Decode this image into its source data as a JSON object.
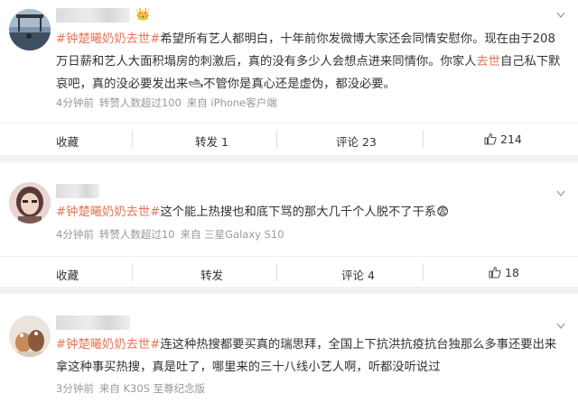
{
  "posts": [
    {
      "topic": "#钟楚曦奶奶去世#",
      "lines": [
        {
          "pre": "希望所有艺人都明白，十年前你发微博大家还会同情安慰你。现在由于208",
          "hl": "",
          "post": ""
        },
        {
          "pre": "万日薪和艺人大面积塌房的刺激后，真的没有多少人会想点进来同情你。你家人",
          "hl": "去世",
          "post": "自己私下默"
        },
        {
          "pre": "哀吧，真的没必要发出来",
          "emoji": "🛥",
          "post2": "不管你是真心还是虚伪，都没必要。"
        }
      ],
      "meta": {
        "time": "4分钟前",
        "extra": "转赞人数超过100",
        "source": "来自 iPhone客户端"
      },
      "actions": {
        "fav": "收藏",
        "repost": "转发 1",
        "comment": "评论 23",
        "like": "214"
      }
    },
    {
      "topic": "#钟楚曦奶奶去世#",
      "text": "这个能上热搜也和底下骂的那大几千个人脱不了干系",
      "emoji": "😨",
      "meta": {
        "time": "4分钟前",
        "extra": "转赞人数超过10",
        "source": "来自 三星Galaxy S10"
      },
      "actions": {
        "fav": "收藏",
        "repost": "转发",
        "comment": "评论 4",
        "like": "18"
      }
    },
    {
      "topic": "#钟楚曦奶奶去世#",
      "lines": [
        {
          "text": "连这种热搜都要买真的瑞思拜，全国上下抗洪抗疫抗台独那么多事还要出来"
        },
        {
          "text": "拿这种事买热搜，真是吐了，哪里来的三十八线小艺人啊，听都没听说过"
        }
      ],
      "meta": {
        "time": "3分钟前",
        "source": "来自 K30S 至尊纪念版"
      }
    }
  ],
  "colors": {
    "topic": "#eb7350",
    "meta": "#999999",
    "divider": "#eeeeee"
  }
}
